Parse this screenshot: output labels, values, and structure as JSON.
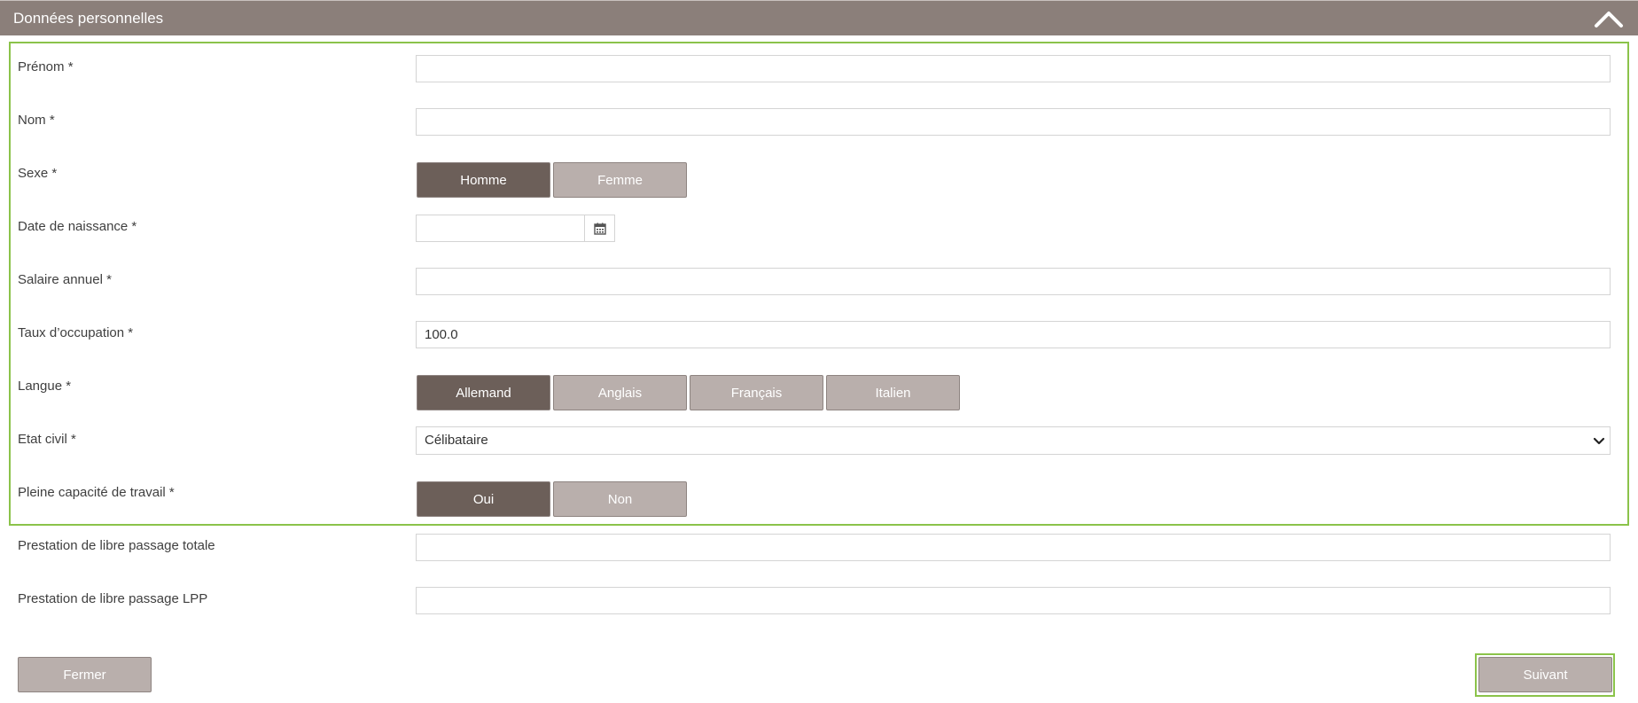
{
  "header": {
    "title": "Données personnelles",
    "collapse_icon": "chevron-up-icon"
  },
  "form": {
    "first_name": {
      "label": "Prénom *",
      "value": ""
    },
    "last_name": {
      "label": "Nom *",
      "value": ""
    },
    "sex": {
      "label": "Sexe *",
      "options": [
        "Homme",
        "Femme"
      ],
      "selected": "Homme"
    },
    "birth_date": {
      "label": "Date de naissance *",
      "value": "",
      "icon": "calendar-icon"
    },
    "annual_salary": {
      "label": "Salaire annuel *",
      "value": ""
    },
    "occupation_rate": {
      "label": "Taux d’occupation *",
      "value": "100.0"
    },
    "language": {
      "label": "Langue *",
      "options": [
        "Allemand",
        "Anglais",
        "Français",
        "Italien"
      ],
      "selected": "Allemand"
    },
    "civil_status": {
      "label": "Etat civil *",
      "value": "Célibataire"
    },
    "full_work_capacity": {
      "label": "Pleine capacité de travail *",
      "options": [
        "Oui",
        "Non"
      ],
      "selected": "Oui"
    },
    "total_vested_benefit": {
      "label": "Prestation de libre passage totale",
      "value": ""
    },
    "lpp_vested_benefit": {
      "label": "Prestation de libre passage LPP",
      "value": ""
    }
  },
  "footer": {
    "close_label": "Fermer",
    "next_label": "Suivant"
  },
  "colors": {
    "header_bg": "#8b7f7a",
    "active_button": "#6c5f59",
    "inactive_button": "#b9afac",
    "focus_outline": "#8bc34a"
  }
}
